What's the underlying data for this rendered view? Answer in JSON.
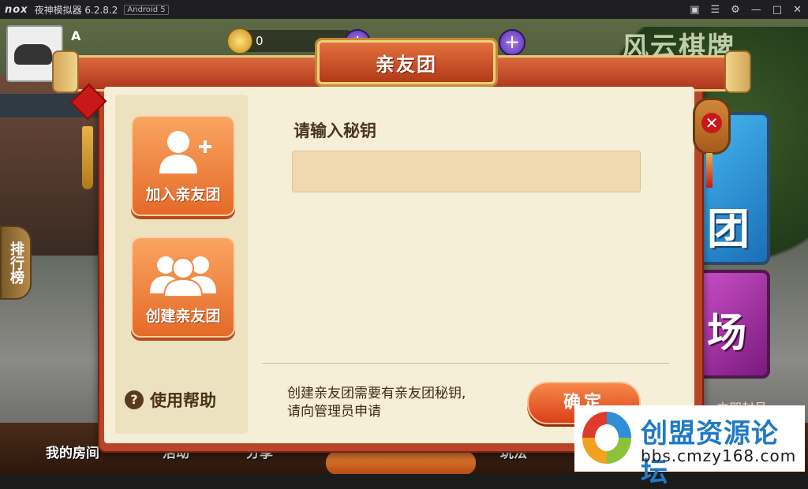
{
  "emulator": {
    "logo": "nox",
    "app_name": "夜神模拟器 6.2.8.2",
    "android_badge": "Android 5",
    "controls": [
      "shirt-icon",
      "menu-icon",
      "gear-icon",
      "minimize-icon",
      "maximize-icon",
      "close-icon"
    ]
  },
  "game": {
    "player_name": "A",
    "coins": "0",
    "logo_text": "风云棋牌",
    "side_tab": "排行榜",
    "card_blue_char": "团",
    "card_purple_text": "场",
    "right_bottom_text": "立即封号",
    "bottom_nav": [
      "我的房间",
      "活动",
      "分享",
      "玩法"
    ]
  },
  "dialog": {
    "title": "亲友团",
    "join_label": "加入亲友团",
    "create_label": "创建亲友团",
    "help_label": "使用帮助",
    "prompt_label": "请输入秘钥",
    "input_value": "",
    "notice_line1": "创建亲友团需要有亲友团秘钥,",
    "notice_line2": "请向管理员申请",
    "confirm_label": "确定",
    "close_symbol": "✕"
  },
  "watermark": {
    "title": "创盟资源论坛",
    "url": "bbs.cmzy168.com"
  }
}
